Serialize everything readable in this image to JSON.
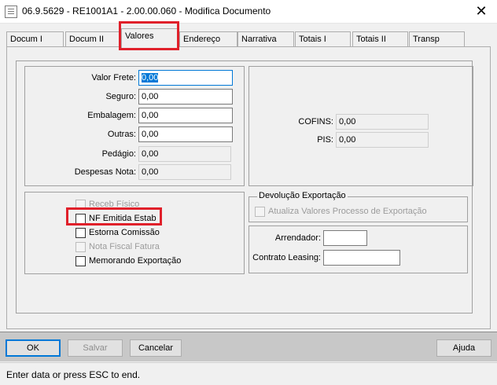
{
  "window": {
    "title": "06.9.5629 - RE1001A1 - 2.00.00.060 - Modifica Documento",
    "close_glyph": "✕"
  },
  "tabs": [
    "Docum I",
    "Docum II",
    "Valores",
    "Endereço",
    "Narrativa",
    "Totais I",
    "Totais II",
    "Transp"
  ],
  "active_tab": "Valores",
  "valores": {
    "valor_frete": {
      "label": "Valor Frete:",
      "value": "0,00"
    },
    "seguro": {
      "label": "Seguro:",
      "value": "0,00"
    },
    "embalagem": {
      "label": "Embalagem:",
      "value": "0,00"
    },
    "outras": {
      "label": "Outras:",
      "value": "0,00"
    },
    "pedagio": {
      "label": "Pedágio:",
      "value": "0,00"
    },
    "despesas_nota": {
      "label": "Despesas Nota:",
      "value": "0,00"
    }
  },
  "impostos": {
    "cofins": {
      "label": "COFINS:",
      "value": "0,00"
    },
    "pis": {
      "label": "PIS:",
      "value": "0,00"
    }
  },
  "checkboxes": {
    "receb_fisico": "Receb Físico",
    "nf_emitida_estab": "NF Emitida Estab",
    "estorna_comissao": "Estorna Comissão",
    "nota_fiscal_fatura": "Nota Fiscal Fatura",
    "memorando_exportacao": "Memorando Exportação"
  },
  "devolucao": {
    "legend": "Devolução Exportação",
    "atualiza": "Atualiza Valores Processo de Exportação"
  },
  "leasing": {
    "arrendador_label": "Arrendador:",
    "arrendador_value": "",
    "contrato_label": "Contrato Leasing:",
    "contrato_value": ""
  },
  "buttons": {
    "ok": "OK",
    "salvar": "Salvar",
    "cancelar": "Cancelar",
    "ajuda": "Ajuda"
  },
  "status": "Enter data or press ESC to end.",
  "colors": {
    "highlight": "#e0202a",
    "focus": "#0078d7"
  }
}
